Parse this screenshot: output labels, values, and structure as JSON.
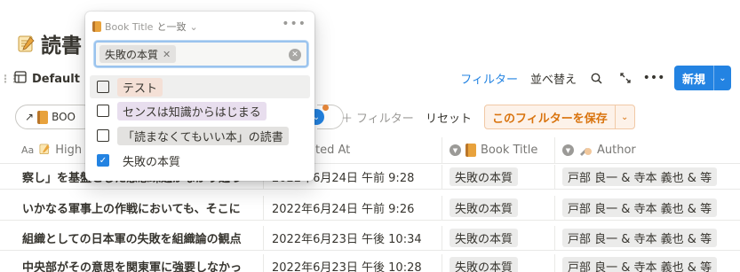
{
  "page": {
    "title": "読書",
    "title_icon": "memo-icon"
  },
  "view": {
    "tab_label": "Default"
  },
  "toolbar": {
    "filter_label": "フィルター",
    "sort_label": "並べ替え",
    "new_label": "新規",
    "colors": {
      "accent": "#2383e2"
    }
  },
  "filter_bar": {
    "source_pill_label": "BOO",
    "add_filter_label": "フィルター",
    "reset_label": "リセット",
    "save_filter_label": "このフィルターを保存",
    "colors": {
      "save": "#d9730d",
      "active_dot": "#e8883a"
    }
  },
  "popup": {
    "property_label": "Book Title",
    "operator_label": "と一致",
    "selected_chip": "失敗の本質",
    "options": [
      {
        "label": "テスト",
        "checked": false,
        "color": "#f4e0d6"
      },
      {
        "label": "センスは知識からはじまる",
        "checked": false,
        "color": "#e8deee"
      },
      {
        "label": "「読まなくてもいい本」の読書",
        "checked": false,
        "color": "#e3e2e0"
      },
      {
        "label": "失敗の本質",
        "checked": true,
        "color": "#ffffff"
      }
    ]
  },
  "table": {
    "columns": {
      "highlight": "High",
      "created": "ted At",
      "book_title": "Book Title",
      "author": "Author"
    },
    "rows": [
      {
        "highlight": "察し」を基盤とした意思疎通がなかり通っ",
        "created": "2022年6月24日 午前 9:28",
        "book": "失敗の本質",
        "author": "戸部 良一 & 寺本 義也 & 等"
      },
      {
        "highlight": "いかなる軍事上の作戦においても、そこに",
        "created": "2022年6月24日 午前 9:26",
        "book": "失敗の本質",
        "author": "戸部 良一 & 寺本 義也 & 等"
      },
      {
        "highlight": "組織としての日本軍の失敗を組織論の観点",
        "created": "2022年6月23日 午後 10:34",
        "book": "失敗の本質",
        "author": "戸部 良一 & 寺本 義也 & 等"
      },
      {
        "highlight": "中央部がその意思を関東軍に強要しなかっ",
        "created": "2022年6月23日 午後 10:28",
        "book": "失敗の本質",
        "author": "戸部 良一 & 寺本 義也 & 等"
      }
    ]
  }
}
